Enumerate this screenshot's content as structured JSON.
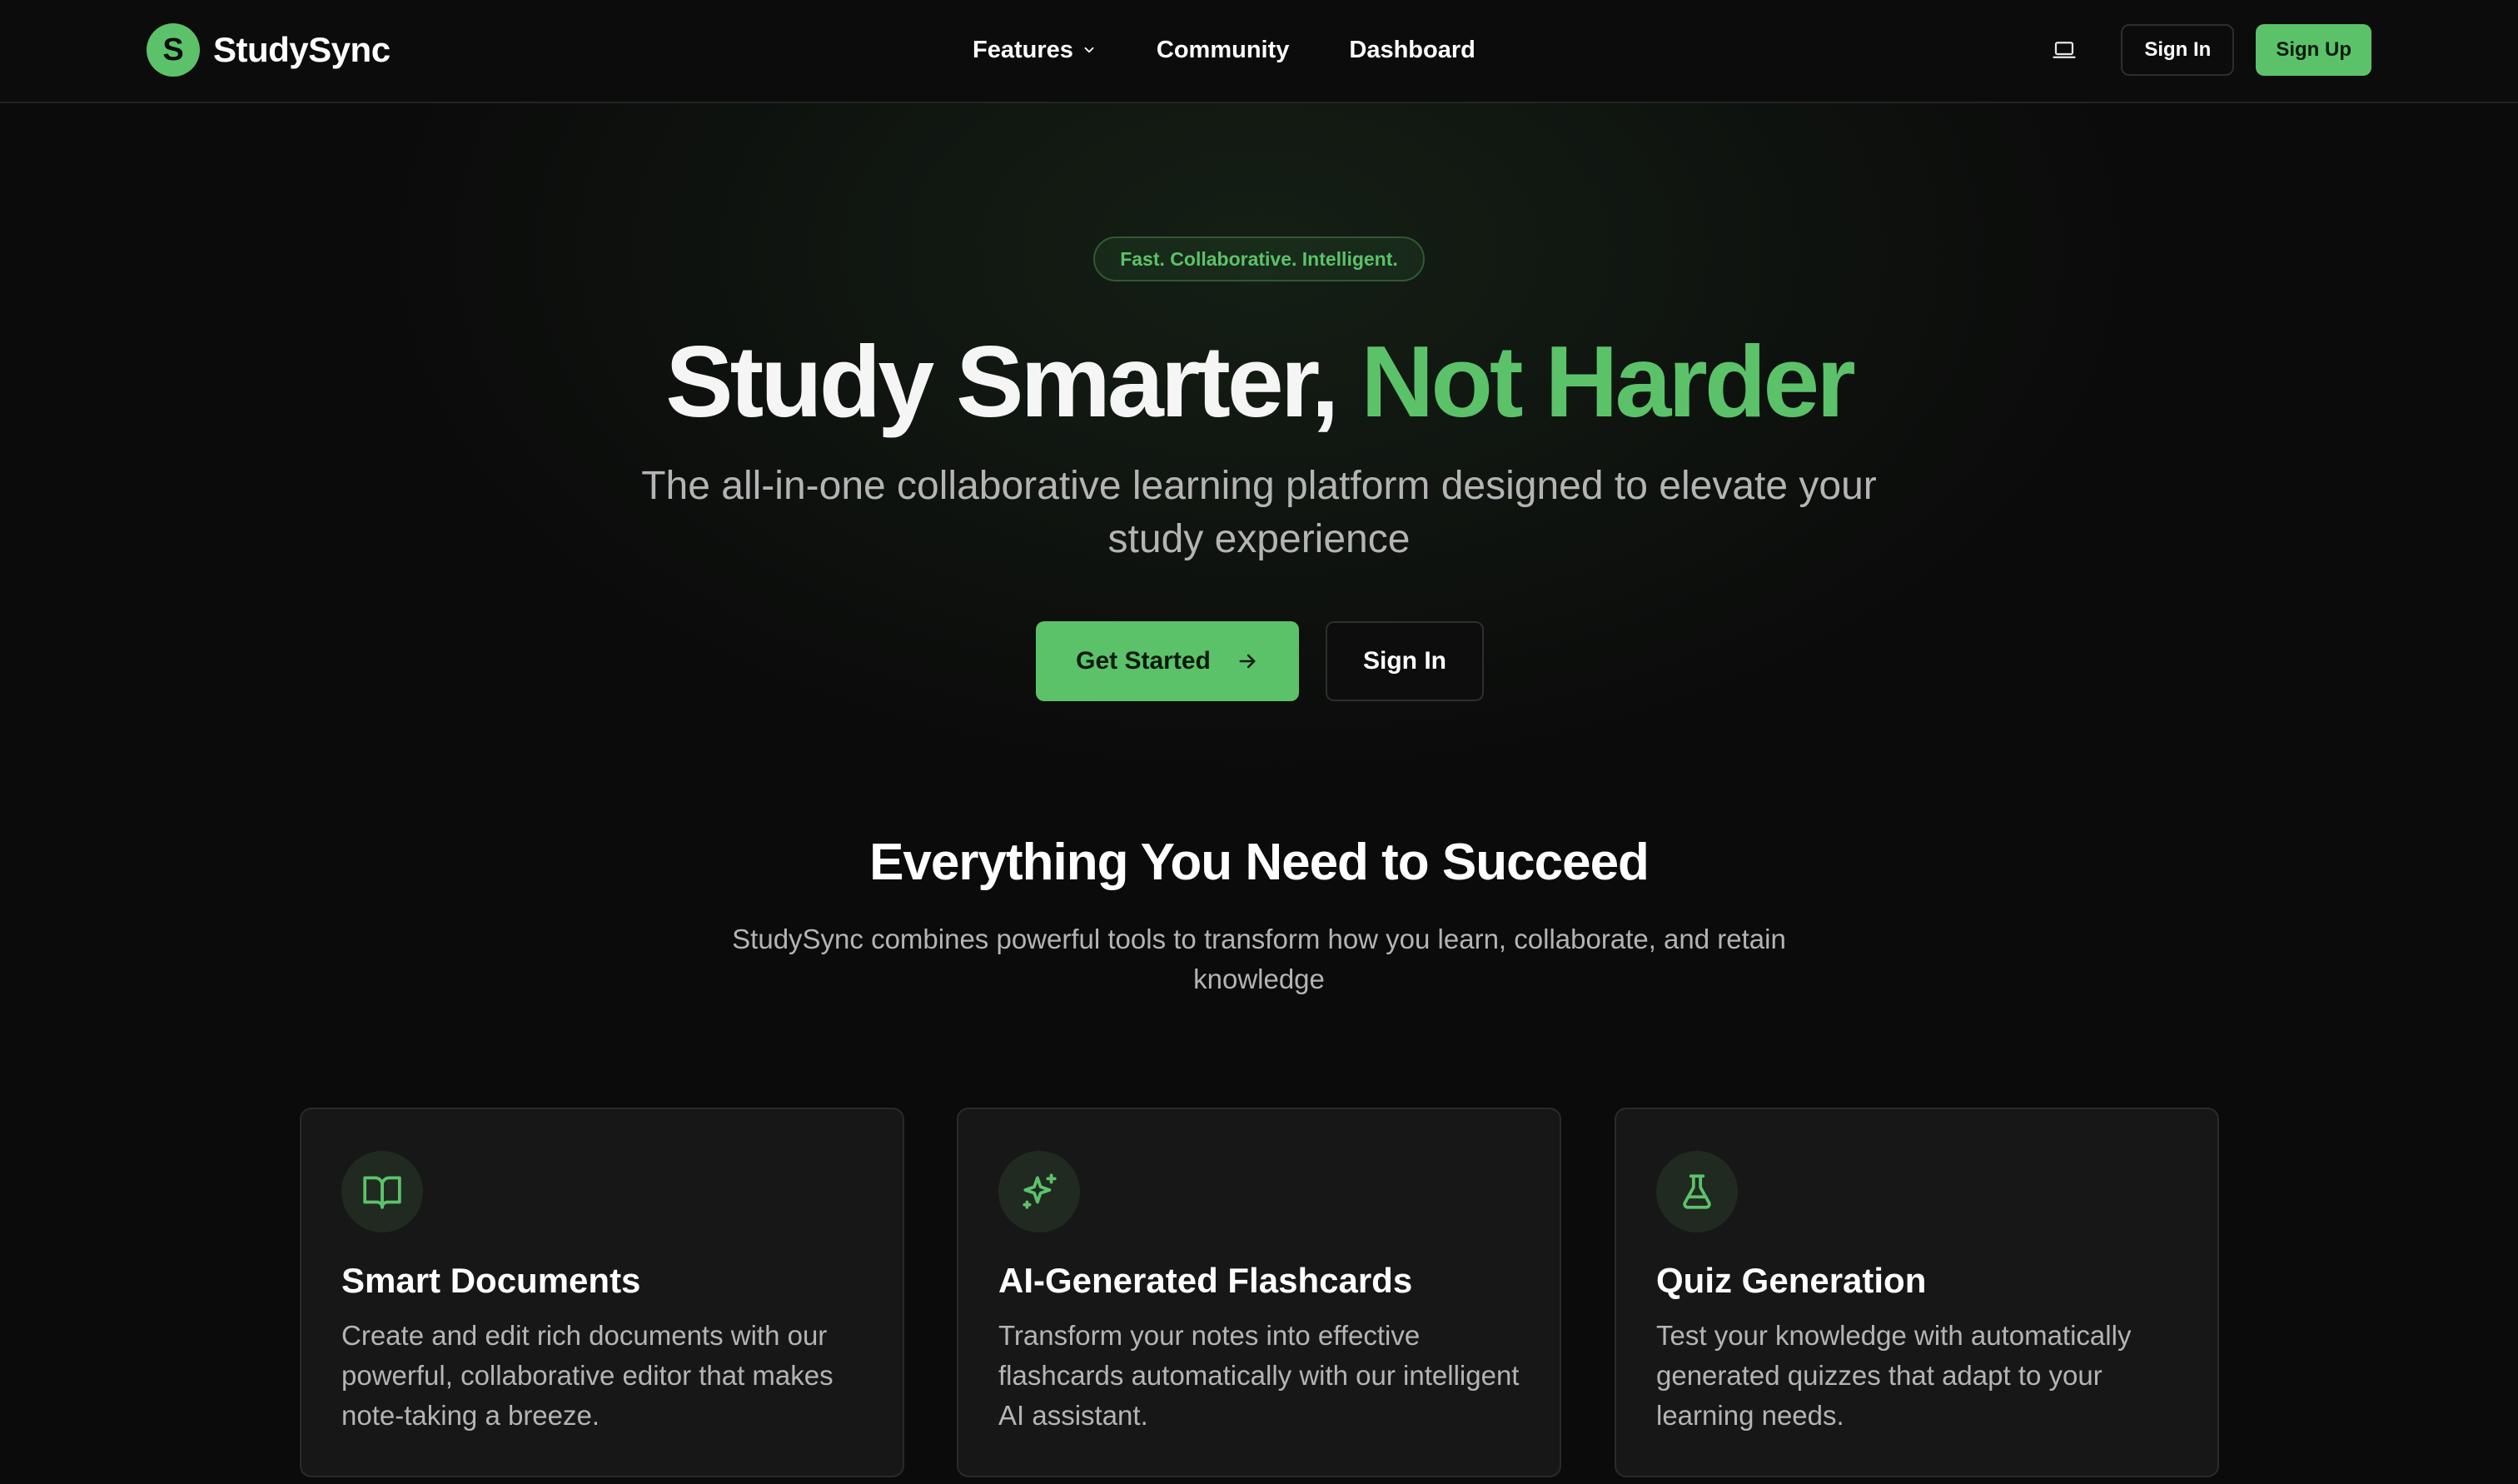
{
  "brand": {
    "logo_letter": "S",
    "name": "StudySync"
  },
  "nav": {
    "links": [
      {
        "label": "Features",
        "has_dropdown": true
      },
      {
        "label": "Community"
      },
      {
        "label": "Dashboard"
      }
    ],
    "theme_icon": "laptop-icon",
    "sign_in": "Sign In",
    "sign_up": "Sign Up"
  },
  "hero": {
    "badge": "Fast. Collaborative. Intelligent.",
    "title_main": "Study Smarter, ",
    "title_accent": "Not Harder",
    "subtitle": "The all-in-one collaborative learning platform designed to elevate your study experience",
    "primary_cta": "Get Started",
    "secondary_cta": "Sign In"
  },
  "features": {
    "title": "Everything You Need to Succeed",
    "subtitle": "StudySync combines powerful tools to transform how you learn, collaborate, and retain knowledge",
    "cards": [
      {
        "icon": "book-open-icon",
        "title": "Smart Documents",
        "description": "Create and edit rich documents with our powerful, collaborative editor that makes note-taking a breeze."
      },
      {
        "icon": "sparkles-icon",
        "title": "AI-Generated Flashcards",
        "description": "Transform your notes into effective flashcards automatically with our intelligent AI assistant."
      },
      {
        "icon": "flask-icon",
        "title": "Quiz Generation",
        "description": "Test your knowledge with automatically generated quizzes that adapt to your learning needs."
      }
    ]
  },
  "colors": {
    "accent": "#5cc26a",
    "background": "#0b0b0b",
    "card": "#171717",
    "muted_text": "#b4b4b4"
  }
}
